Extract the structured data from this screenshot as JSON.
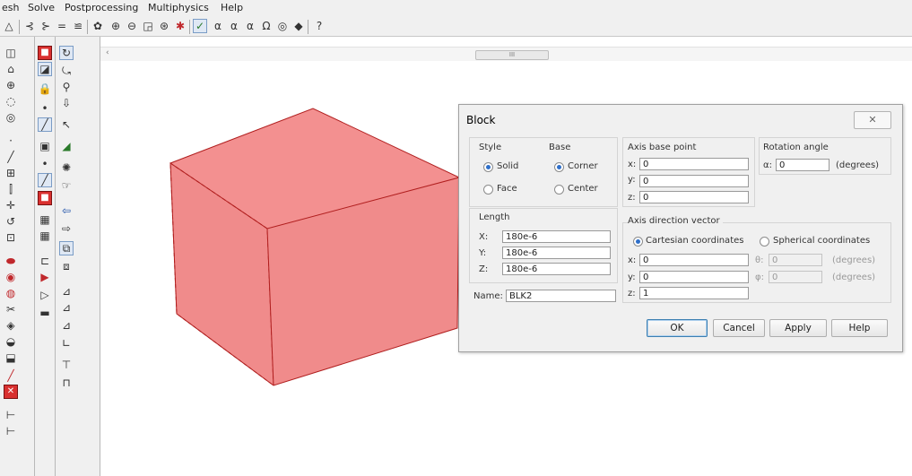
{
  "menubar": {
    "items": [
      "esh",
      "Solve",
      "Postprocessing",
      "Multiphysics",
      "Help"
    ]
  },
  "toolbar": {
    "icons": [
      "triangle-icon",
      "lines-icon",
      "lines-icon",
      "equals-icon",
      "tree-icon",
      "zoom-icon",
      "zoom-in-icon",
      "zoom-out-icon",
      "zoom-window-icon",
      "zoom-extents-icon",
      "axis-icon",
      "scene-light-icon",
      "alpha-icon",
      "alpha-icon",
      "alpha-icon",
      "omega-icon",
      "target-icon",
      "bulb-icon",
      "help-icon"
    ]
  },
  "scrollbar": {
    "thumb_label": "III",
    "left_arrow": "‹"
  },
  "colors": {
    "cube_front": "#f08b8b",
    "cube_top": "#f39090",
    "cube_edge": "#b01e1e",
    "accent": "#2f6fc9"
  },
  "dialog": {
    "title": "Block",
    "close_label": "✕",
    "style": {
      "title": "Style",
      "options": [
        "Solid",
        "Face"
      ],
      "selected": "Solid"
    },
    "base": {
      "title": "Base",
      "options": [
        "Corner",
        "Center"
      ],
      "selected": "Corner"
    },
    "axis_base_point": {
      "title": "Axis base point",
      "x_label": "x:",
      "x_value": "0",
      "y_label": "y:",
      "y_value": "0",
      "z_label": "z:",
      "z_value": "0"
    },
    "rotation_angle": {
      "title": "Rotation angle",
      "alpha_label": "α:",
      "alpha_value": "0",
      "unit": "(degrees)"
    },
    "length": {
      "title": "Length",
      "x_label": "X:",
      "x_value": "180e-6",
      "y_label": "Y:",
      "y_value": "180e-6",
      "z_label": "Z:",
      "z_value": "180e-6"
    },
    "axis_direction_vector": {
      "title": "Axis direction vector",
      "options": [
        "Cartesian coordinates",
        "Spherical coordinates"
      ],
      "selected": "Cartesian coordinates",
      "x_label": "x:",
      "x_value": "0",
      "y_label": "y:",
      "y_value": "0",
      "z_label": "z:",
      "z_value": "1",
      "theta_label": "θ:",
      "theta_value": "0",
      "phi_label": "φ:",
      "phi_value": "0",
      "unit": "(degrees)"
    },
    "name": {
      "label": "Name:",
      "value": "BLK2"
    },
    "buttons": {
      "ok": "OK",
      "cancel": "Cancel",
      "apply": "Apply",
      "help": "Help"
    }
  }
}
